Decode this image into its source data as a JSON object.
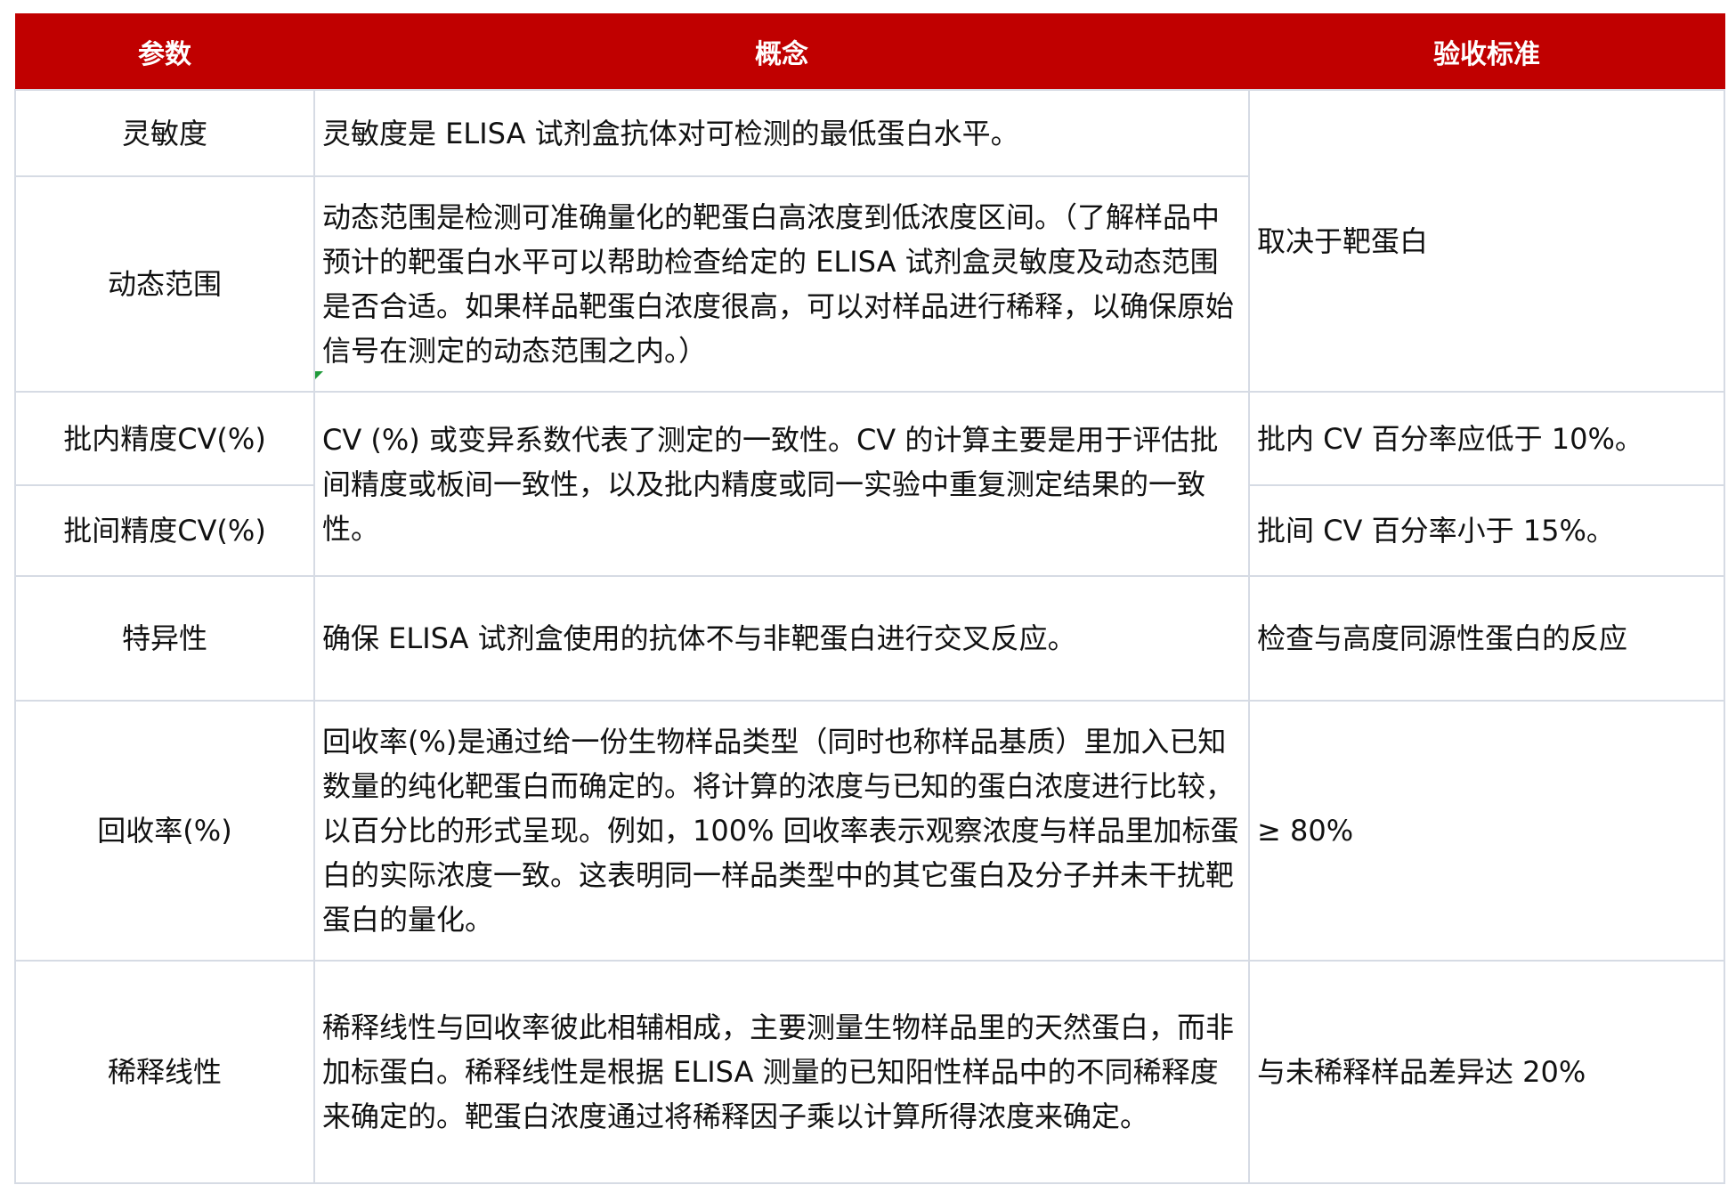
{
  "headers": {
    "param": "参数",
    "concept": "概念",
    "criteria": "验收标准"
  },
  "rows": {
    "sensitivity": {
      "param": "灵敏度",
      "concept": "灵敏度是 ELISA 试剂盒抗体对可检测的最低蛋白水平。"
    },
    "dynamic_range": {
      "param": "动态范围",
      "concept": "动态范围是检测可准确量化的靶蛋白高浓度到低浓度区间。（了解样品中预计的靶蛋白水平可以帮助检查给定的 ELISA 试剂盒灵敏度及动态范围是否合适。如果样品靶蛋白浓度很高，可以对样品进行稀释，以确保原始信号在测定的动态范围之内。）"
    },
    "shared_criteria_sens_dyn": "取决于靶蛋白",
    "intra_cv": {
      "param": "批内精度CV(%)",
      "criteria": "批内 CV 百分率应低于 10%。"
    },
    "inter_cv": {
      "param": "批间精度CV(%)",
      "criteria": "批间 CV 百分率小于 15%。"
    },
    "shared_concept_cv": "CV (%) 或变异系数代表了测定的一致性。CV 的计算主要是用于评估批间精度或板间一致性，以及批内精度或同一实验中重复测定结果的一致性。",
    "specificity": {
      "param": "特异性",
      "concept": "确保 ELISA 试剂盒使用的抗体不与非靶蛋白进行交叉反应。",
      "criteria": "检查与高度同源性蛋白的反应"
    },
    "recovery": {
      "param": "回收率(%)",
      "concept": "回收率(%)是通过给一份生物样品类型（同时也称样品基质）里加入已知数量的纯化靶蛋白而确定的。将计算的浓度与已知的蛋白浓度进行比较，以百分比的形式呈现。例如，100% 回收率表示观察浓度与样品里加标蛋白的实际浓度一致。这表明同一样品类型中的其它蛋白及分子并未干扰靶蛋白的量化。",
      "criteria": "≥ 80%"
    },
    "dilution_linearity": {
      "param": "稀释线性",
      "concept": "稀释线性与回收率彼此相辅相成，主要测量生物样品里的天然蛋白，而非加标蛋白。稀释线性是根据 ELISA 测量的已知阳性样品中的不同稀释度来确定的。靶蛋白浓度通过将稀释因子乘以计算所得浓度来确定。",
      "criteria": "与未稀释样品差异达 20%"
    }
  },
  "colors": {
    "header_bg": "#c00000",
    "header_text": "#ffffff",
    "grid": "#d6dbe4",
    "comment_marker": "#1f9a3a"
  }
}
